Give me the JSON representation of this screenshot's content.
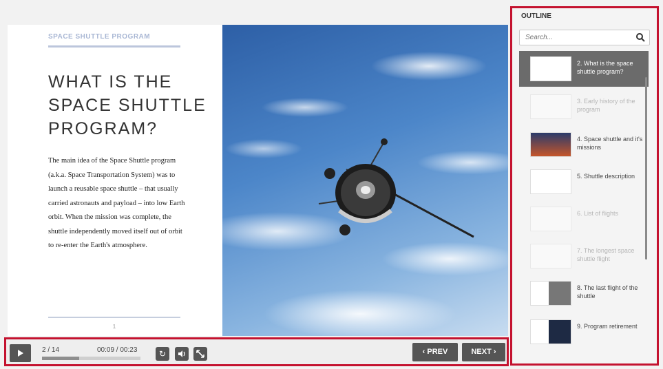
{
  "slide": {
    "kicker": "SPACE SHUTTLE PROGRAM",
    "title_lines": [
      "WHAT IS THE",
      "SPACE SHUTTLE",
      "PROGRAM?"
    ],
    "body": "The main idea of the Space Shuttle program (a.k.a. Space Transportation System) was to launch a reusable space shuttle – that usually carried astronauts and payload – into low Earth orbit. When the mission was complete, the shuttle independently moved itself out of orbit to re-enter the Earth's atmosphere.",
    "page_number": "1"
  },
  "controls": {
    "slide_count": "2 / 14",
    "time": "00:09 / 00:23",
    "progress_fraction": 0.38,
    "prev_label": "PREV",
    "next_label": "NEXT"
  },
  "outline": {
    "title": "OUTLINE",
    "search_placeholder": "Search...",
    "items": [
      {
        "label": "2. What is the space shuttle program?",
        "state": "active"
      },
      {
        "label": "3. Early history of the program",
        "state": "dim"
      },
      {
        "label": "4. Space shuttle and it's missions",
        "state": "normal"
      },
      {
        "label": "5. Shuttle description",
        "state": "normal"
      },
      {
        "label": "6. List of flights",
        "state": "dim"
      },
      {
        "label": "7. The longest space shuttle flight",
        "state": "dim"
      },
      {
        "label": "8. The last flight of the shuttle",
        "state": "normal"
      },
      {
        "label": "9. Program retirement",
        "state": "normal"
      }
    ]
  },
  "colors": {
    "highlight_border": "#c4122f",
    "button_bg": "#555555"
  }
}
